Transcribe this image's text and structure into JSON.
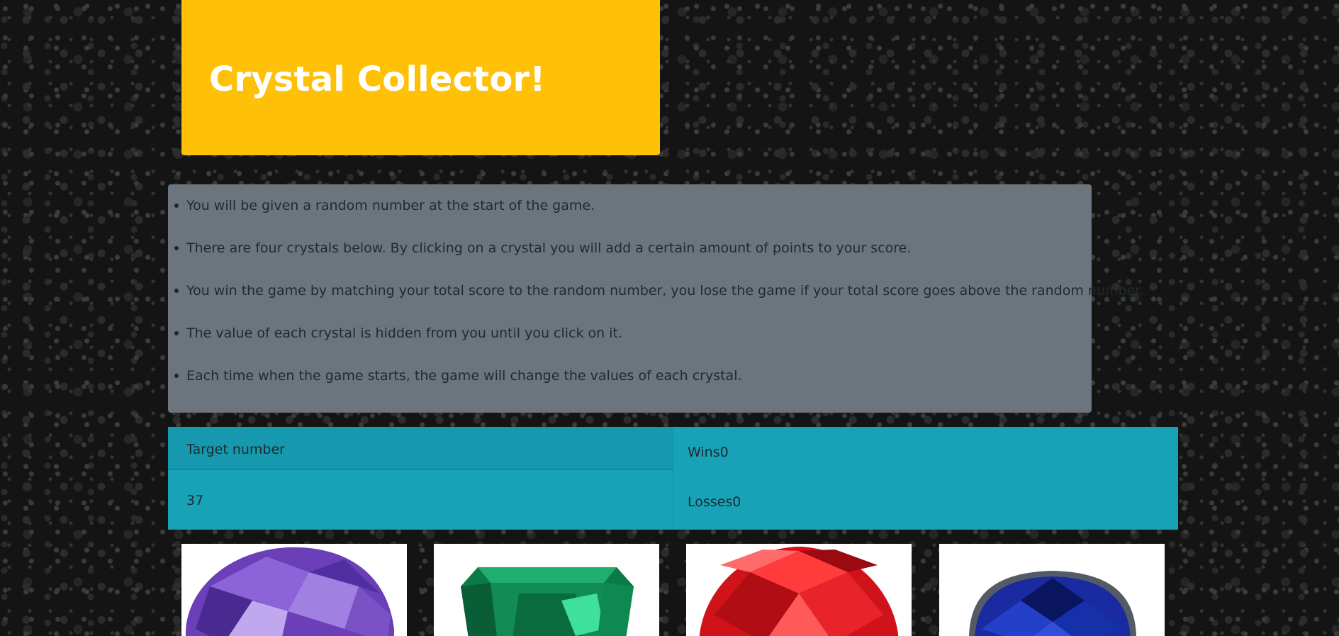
{
  "header": {
    "title": "Crystal Collector!"
  },
  "instructions": [
    "You will be given a random number at the start of the game.",
    "There are four crystals below. By clicking on a crystal you will add a certain amount of points to your score.",
    "You win the game by matching your total score to the random number, you lose the game if your total score goes above the random number.",
    "The value of each crystal is hidden from you until you click on it.",
    "Each time when the game starts, the game will change the values of each crystal."
  ],
  "scoreboard": {
    "target_label": "Target number",
    "target_value": "37",
    "wins_label": "Wins",
    "wins_value": "0",
    "losses_label": "Losses",
    "losses_value": "0"
  },
  "crystals": [
    {
      "name": "purple-crystal",
      "color": "#7a4fc9"
    },
    {
      "name": "green-crystal",
      "color": "#0f9a5c"
    },
    {
      "name": "red-crystal",
      "color": "#e0141c"
    },
    {
      "name": "blue-crystal",
      "color": "#1c2f9e"
    }
  ],
  "colors": {
    "header_bg": "#ffc107",
    "instructions_bg": "#6c757d",
    "scoreboard_bg": "#17a2b8"
  }
}
